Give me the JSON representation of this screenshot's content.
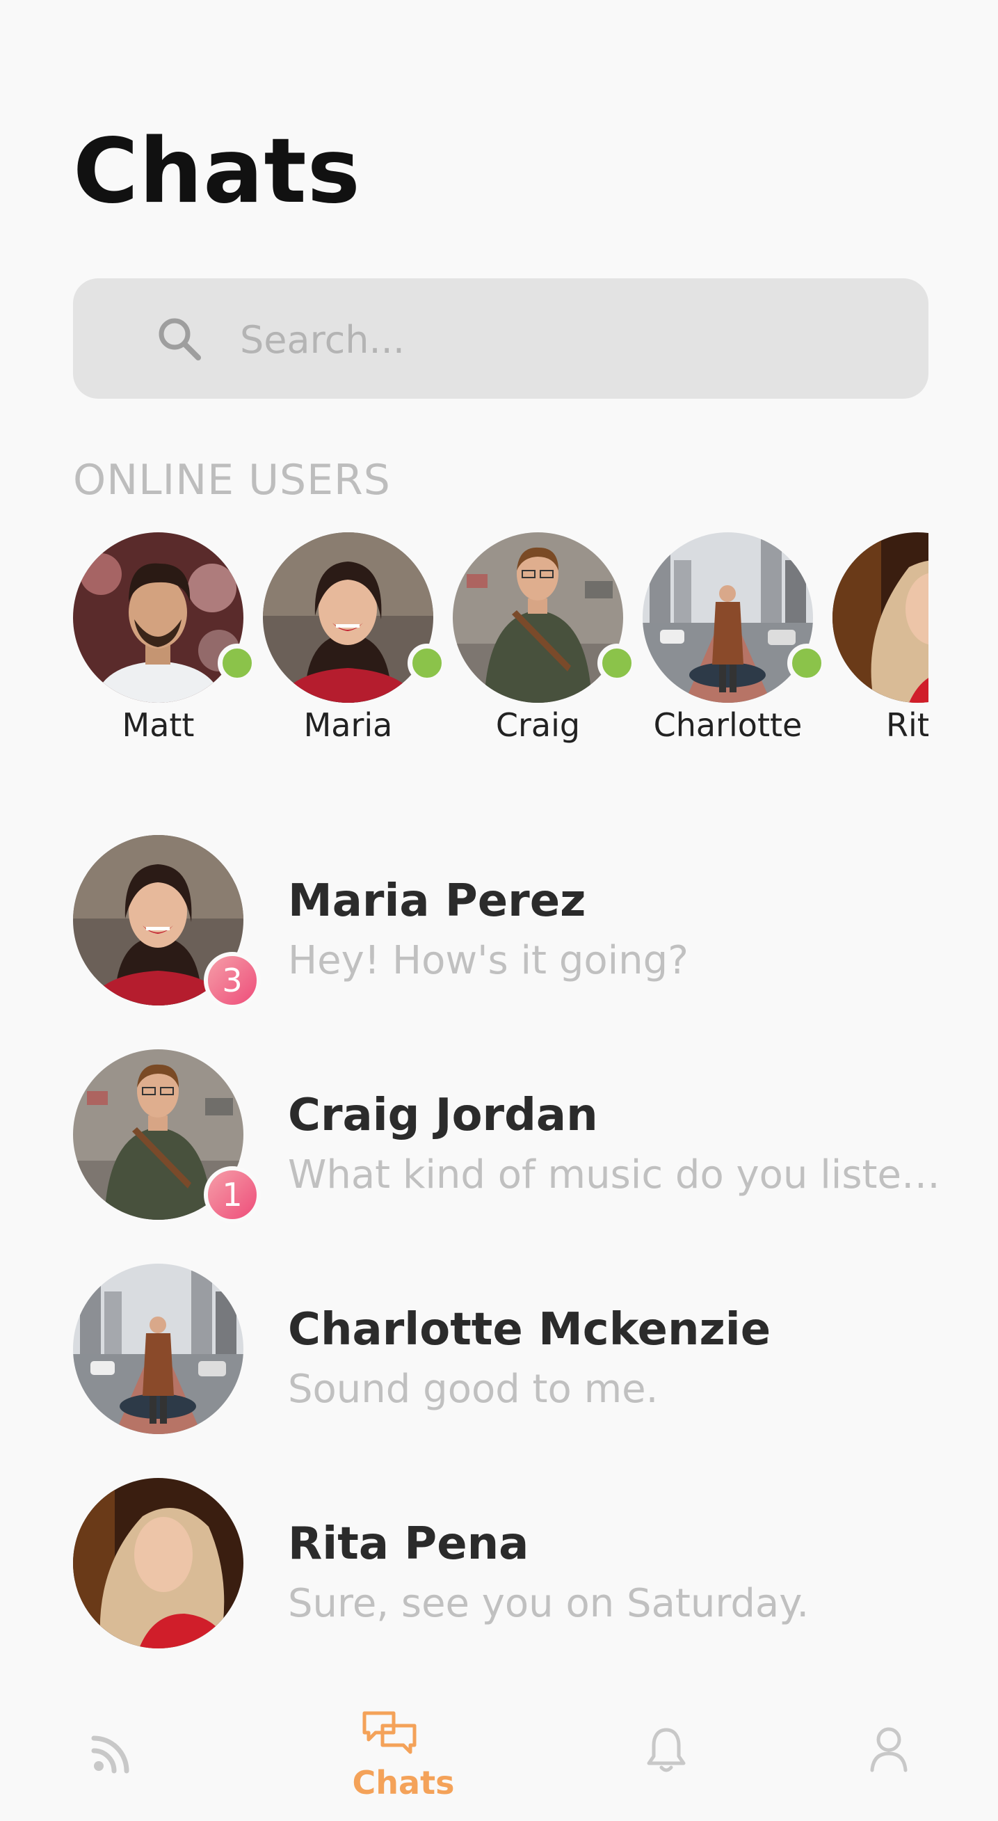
{
  "header": {
    "title": "Chats"
  },
  "search": {
    "placeholder": "Search..."
  },
  "online": {
    "label": "ONLINE USERS",
    "users": [
      {
        "name": "Matt",
        "online": true
      },
      {
        "name": "Maria",
        "online": true
      },
      {
        "name": "Craig",
        "online": true
      },
      {
        "name": "Charlotte",
        "online": true
      },
      {
        "name": "Rita",
        "online": false
      }
    ]
  },
  "chats": [
    {
      "name": "Maria Perez",
      "message": "Hey! How's it going?",
      "unread": "3"
    },
    {
      "name": "Craig Jordan",
      "message": "What kind of music do you listen to?",
      "unread": "1"
    },
    {
      "name": "Charlotte Mckenzie",
      "message": "Sound good to me.",
      "unread": ""
    },
    {
      "name": "Rita Pena",
      "message": "Sure, see you on Saturday.",
      "unread": ""
    }
  ],
  "nav": {
    "items": [
      {
        "icon": "rss-feed-icon",
        "label": ""
      },
      {
        "icon": "chat-bubbles-icon",
        "label": "Chats",
        "active": true
      },
      {
        "icon": "bell-icon",
        "label": ""
      },
      {
        "icon": "user-icon",
        "label": ""
      }
    ],
    "active_color": "#f4a259",
    "inactive_color": "#c8c8c8"
  },
  "colors": {
    "online_dot": "#8bc34a",
    "badge_gradient_start": "#f59ea8",
    "badge_gradient_end": "#ee4d7a",
    "search_bg": "#e3e3e3"
  }
}
